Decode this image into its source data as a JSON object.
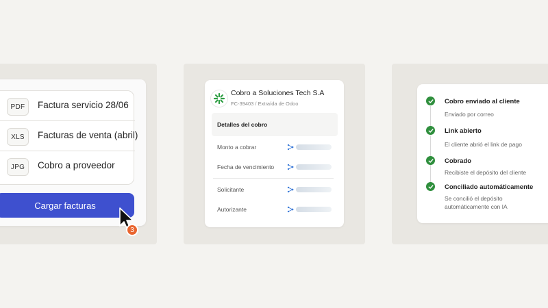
{
  "upload_panel": {
    "files": [
      {
        "type": "PDF",
        "name": "Factura servicio 28/06"
      },
      {
        "type": "XLS",
        "name": "Facturas de venta (abril)"
      },
      {
        "type": "JPG",
        "name": "Cobro a proveedor"
      }
    ],
    "upload_button_label": "Cargar facturas",
    "file_count_badge": "3"
  },
  "collection_panel": {
    "title": "Cobro a Soluciones Tech S.A",
    "subtitle": "FC-39403 / Extraída de Odoo",
    "details_header": "Detalles del cobro",
    "fields": [
      {
        "label": "Monto a cobrar"
      },
      {
        "label": "Fecha de vencimiento"
      },
      {
        "label": "Solicitante"
      },
      {
        "label": "Autorizante"
      }
    ]
  },
  "status_panel": {
    "steps": [
      {
        "title": "Cobro enviado al cliente",
        "description": "Enviado por correo"
      },
      {
        "title": "Link abierto",
        "description": "El cliente abrió el link de pago"
      },
      {
        "title": "Cobrado",
        "description": "Recibiste el depósito del cliente"
      },
      {
        "title": "Conciliado automáticamente",
        "description": "Se concilió el depósito automáticamente con IA"
      }
    ]
  },
  "colors": {
    "primary_button": "#3e50cf",
    "badge": "#e9652f",
    "success": "#2f8f3d"
  }
}
